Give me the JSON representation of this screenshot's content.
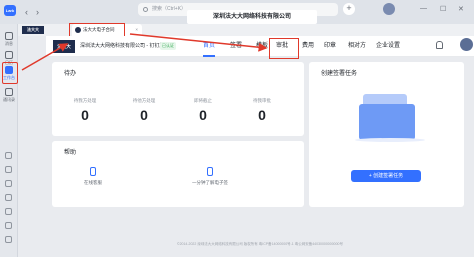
{
  "titlebar": {
    "app_badge": "Lark",
    "search_placeholder": "搜索（Ctrl+K）",
    "plus": "+"
  },
  "tabs": {
    "logo": "法大大",
    "active_tab": "法大大电子合同",
    "close": "×"
  },
  "company": {
    "name": "深圳法大大网络科技有限公司"
  },
  "leftrail": {
    "items": [
      {
        "label": "消息",
        "icon": "message-icon"
      },
      {
        "label": "日历",
        "icon": "calendar-icon"
      },
      {
        "label": "工作台",
        "icon": "workbench-icon"
      },
      {
        "label": "通讯录",
        "icon": "contacts-icon"
      }
    ]
  },
  "header": {
    "brand": "法大大",
    "org": "深圳法大大网络科技有限公司 - 钉钉版",
    "auth": "已认证",
    "nav": [
      {
        "label": "首页",
        "active": true
      },
      {
        "label": "签署"
      },
      {
        "label": "模板"
      },
      {
        "label": "审批"
      },
      {
        "label": "费用"
      },
      {
        "label": "印章"
      },
      {
        "label": "相对方"
      },
      {
        "label": "企业设置"
      }
    ]
  },
  "todo": {
    "title": "待办",
    "stats": [
      {
        "label": "待我方处理",
        "value": "0"
      },
      {
        "label": "待他方处理",
        "value": "0"
      },
      {
        "label": "即将截止",
        "value": "0"
      },
      {
        "label": "待我审批",
        "value": "0"
      }
    ]
  },
  "help": {
    "title": "帮助",
    "items": [
      {
        "label": "在线客服"
      },
      {
        "label": "一分钟了解电子签"
      }
    ]
  },
  "create": {
    "title": "创建签署任务",
    "button": "+ 创建签署任务"
  },
  "footer": {
    "text": "©2014-2022 深圳法大大网络科技有限公司 版权所有 粤ICP备14000000号-1 粤公网安备44030000000000号"
  }
}
